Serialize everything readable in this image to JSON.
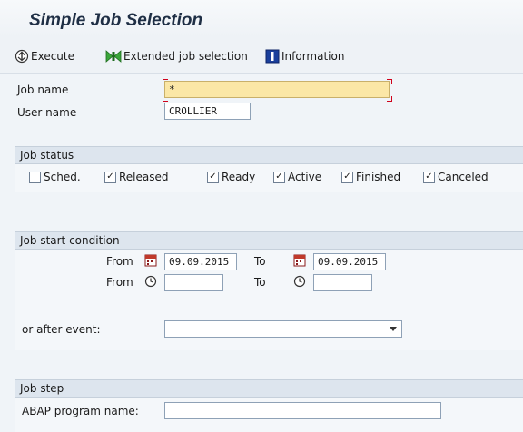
{
  "title": "Simple Job Selection",
  "toolbar": {
    "execute": "Execute",
    "extended": "Extended job selection",
    "information": "Information"
  },
  "job_name": {
    "label": "Job name",
    "value": "*"
  },
  "user_name": {
    "label": "User name",
    "value": "CROLLIER"
  },
  "job_status": {
    "heading": "Job status",
    "items": [
      {
        "label": "Sched.",
        "checked": false
      },
      {
        "label": "Released",
        "checked": true
      },
      {
        "label": "Ready",
        "checked": true
      },
      {
        "label": "Active",
        "checked": true
      },
      {
        "label": "Finished",
        "checked": true
      },
      {
        "label": "Canceled",
        "checked": true
      }
    ]
  },
  "start_condition": {
    "heading": "Job start condition",
    "from_label": "From",
    "to_label": "To",
    "from_date": "09.09.2015",
    "to_date": "09.09.2015",
    "from_time": "",
    "to_time": "",
    "event_label": "or after event:",
    "event_value": ""
  },
  "job_step": {
    "heading": "Job step",
    "program_label": "ABAP program name:",
    "program_value": ""
  },
  "colors": {
    "focus_field": "#fbe7a6",
    "group_header": "#dde5ee",
    "background": "#f0f4f8"
  }
}
